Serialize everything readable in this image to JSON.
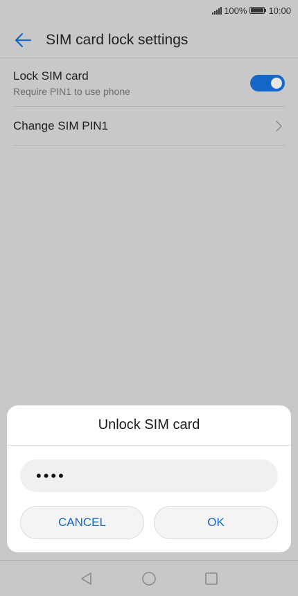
{
  "status_bar": {
    "battery_percent": "100%",
    "time": "10:00",
    "icons": [
      "signal-icon",
      "battery-icon"
    ]
  },
  "toolbar": {
    "title": "SIM card lock settings",
    "back_icon": "arrow-left-icon"
  },
  "settings": {
    "lock_sim": {
      "title": "Lock SIM card",
      "subtitle": "Require PIN1 to use phone",
      "enabled": true
    },
    "change_pin": {
      "title": "Change SIM PIN1",
      "icon": "chevron-right-icon"
    }
  },
  "dialog": {
    "title": "Unlock SIM card",
    "pin_masked": "••••",
    "cancel_label": "CANCEL",
    "ok_label": "OK"
  },
  "nav_bar": {
    "icons": [
      "back-triangle-icon",
      "home-circle-icon",
      "recents-square-icon"
    ]
  },
  "colors": {
    "accent": "#1466c8",
    "dim_background": "#c8c8c8",
    "dialog_background": "#ffffff"
  }
}
